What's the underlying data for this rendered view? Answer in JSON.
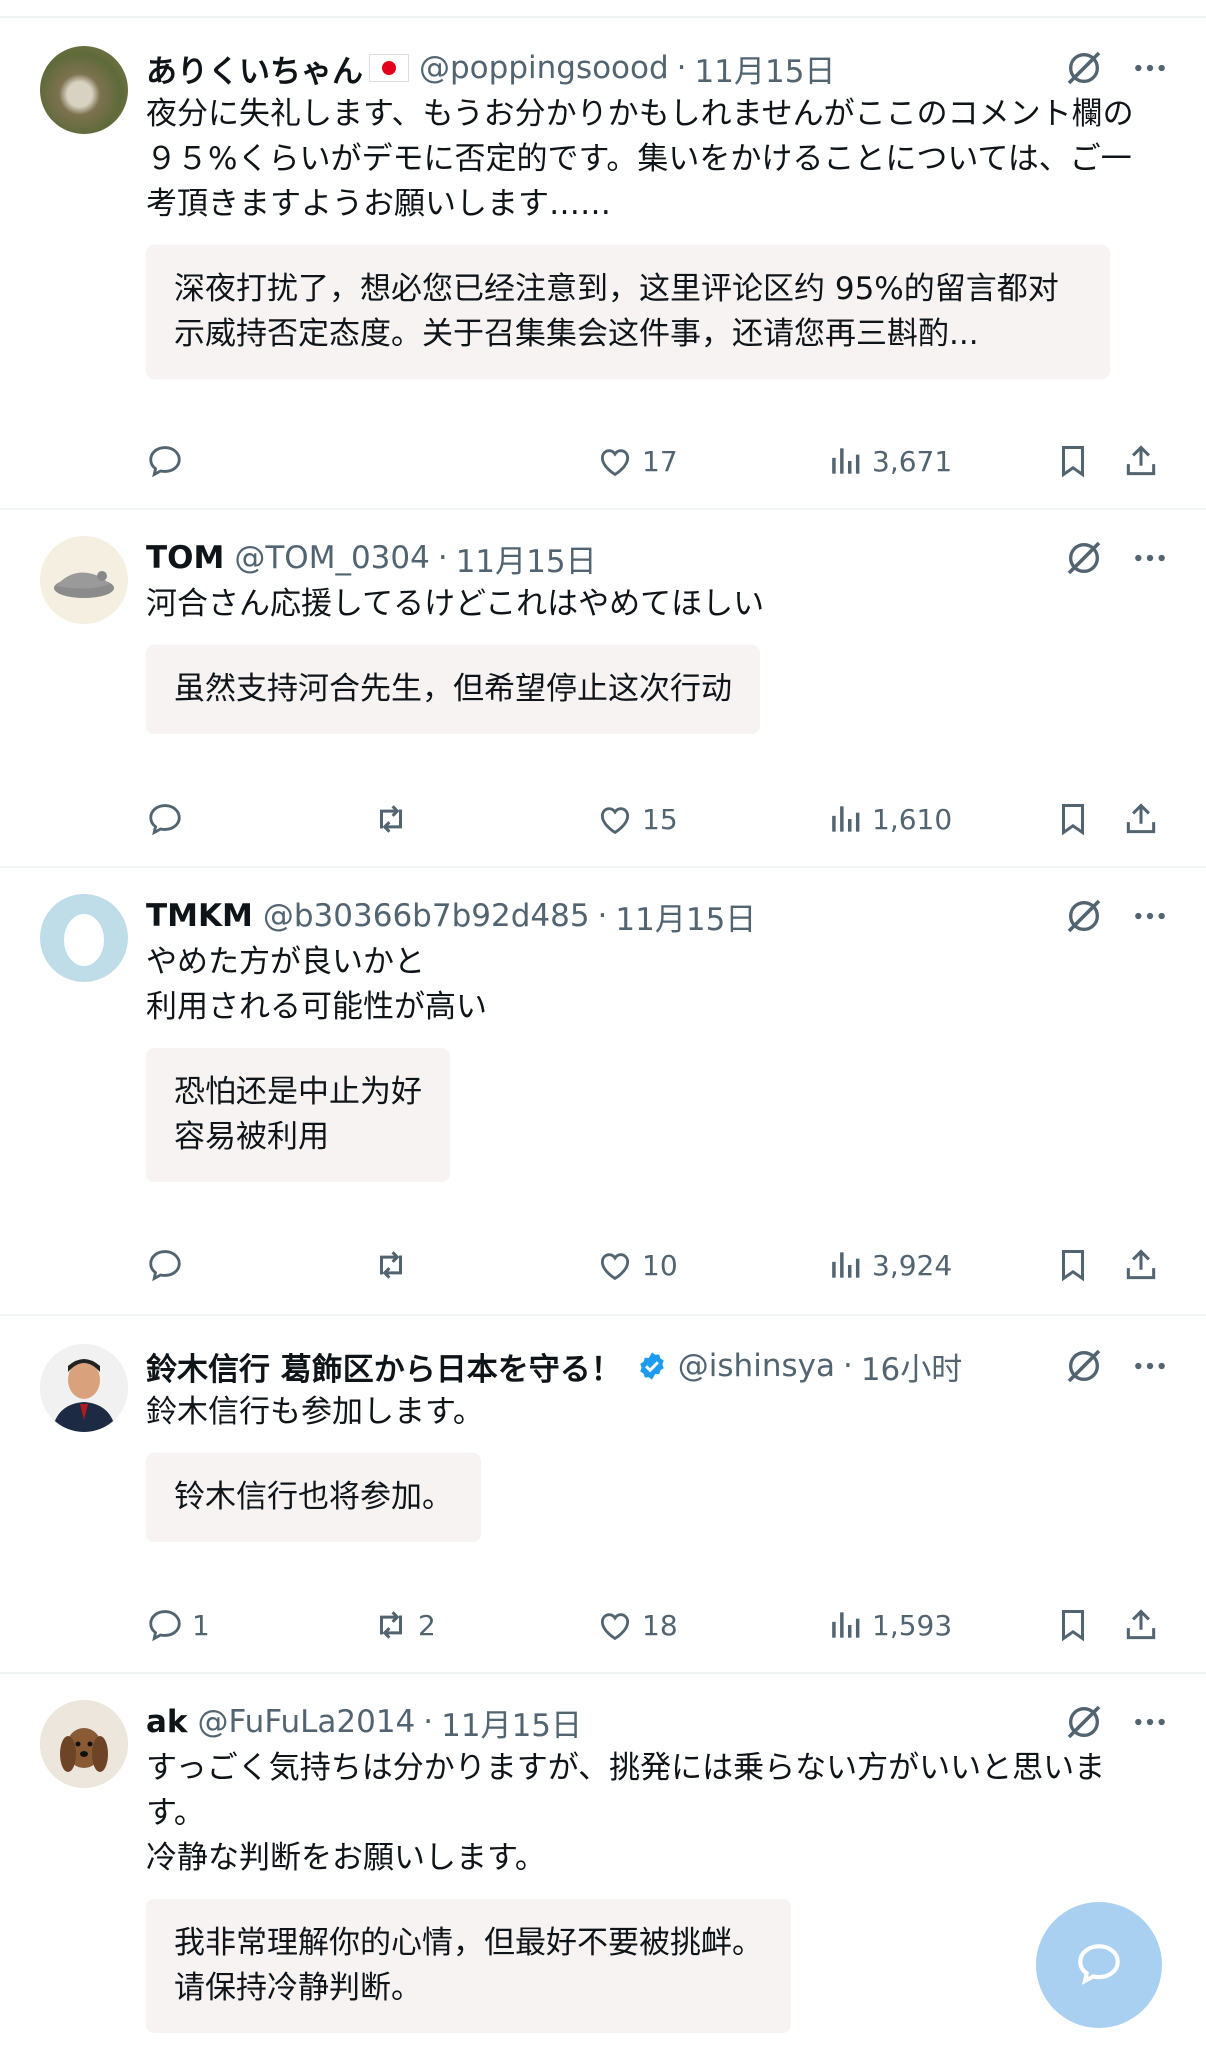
{
  "replies": [
    {
      "name": "ありくいちゃん",
      "has_flag": true,
      "verified": false,
      "handle": "@poppingsoood",
      "time": "11月15日",
      "text": "夜分に失礼します、もうお分かりかもしれませんがここのコメント欄の\n９５%くらいがデモに否定的です。集いをかけることについては、ご一\n考頂きますようお願いします……",
      "translation": "深夜打扰了，想必您已经注意到，这里评论区约 95%的留言都对\n示威持否定态度。关于召集集会这件事，还请您再三斟酌...",
      "reply_count": "",
      "repost_count": "",
      "like_count": "17",
      "view_count": "3,671"
    },
    {
      "name": "TOM",
      "has_flag": false,
      "verified": false,
      "handle": "@TOM_0304",
      "time": "11月15日",
      "text": "河合さん応援してるけどこれはやめてほしい",
      "translation": "虽然支持河合先生，但希望停止这次行动",
      "reply_count": "",
      "repost_count": "",
      "like_count": "15",
      "view_count": "1,610"
    },
    {
      "name": "TMKM",
      "has_flag": false,
      "verified": false,
      "handle": "@b30366b7b92d485",
      "time": "11月15日",
      "text": "やめた方が良いかと\n利用される可能性が高い",
      "translation": "恐怕还是中止为好\n容易被利用",
      "reply_count": "",
      "repost_count": "",
      "like_count": "10",
      "view_count": "3,924"
    },
    {
      "name": "鈴木信行 葛飾区から日本を守る！",
      "has_flag": false,
      "verified": true,
      "handle": "@ishinsya",
      "time": "16小时",
      "text": "鈴木信行も参加します。",
      "translation": "铃木信行也将参加。",
      "reply_count": "1",
      "repost_count": "2",
      "like_count": "18",
      "view_count": "1,593"
    },
    {
      "name": "ak",
      "has_flag": false,
      "verified": false,
      "handle": "@FuFuLa2014",
      "time": "11月15日",
      "text": "すっごく気持ちは分かりますが、挑発には乗らない方がいいと思いま\nす。\n冷静な判断をお願いします。",
      "translation": "我非常理解你的心情，但最好不要被挑衅。\n请保持冷静判断。",
      "reply_count": "",
      "repost_count": "",
      "like_count": "",
      "view_count": ""
    }
  ],
  "icons": [
    "reply-icon",
    "repost-icon",
    "like-icon",
    "views-icon",
    "bookmark-icon",
    "share-icon",
    "grok-icon",
    "more-icon",
    "verified-icon",
    "compose-reply-icon"
  ],
  "colors": {
    "accent": "#1d9bf0",
    "muted": "#536471",
    "translation_bg": "#f7f3f3",
    "fab": "#a9cff1",
    "flag_red": "#e3001b"
  }
}
